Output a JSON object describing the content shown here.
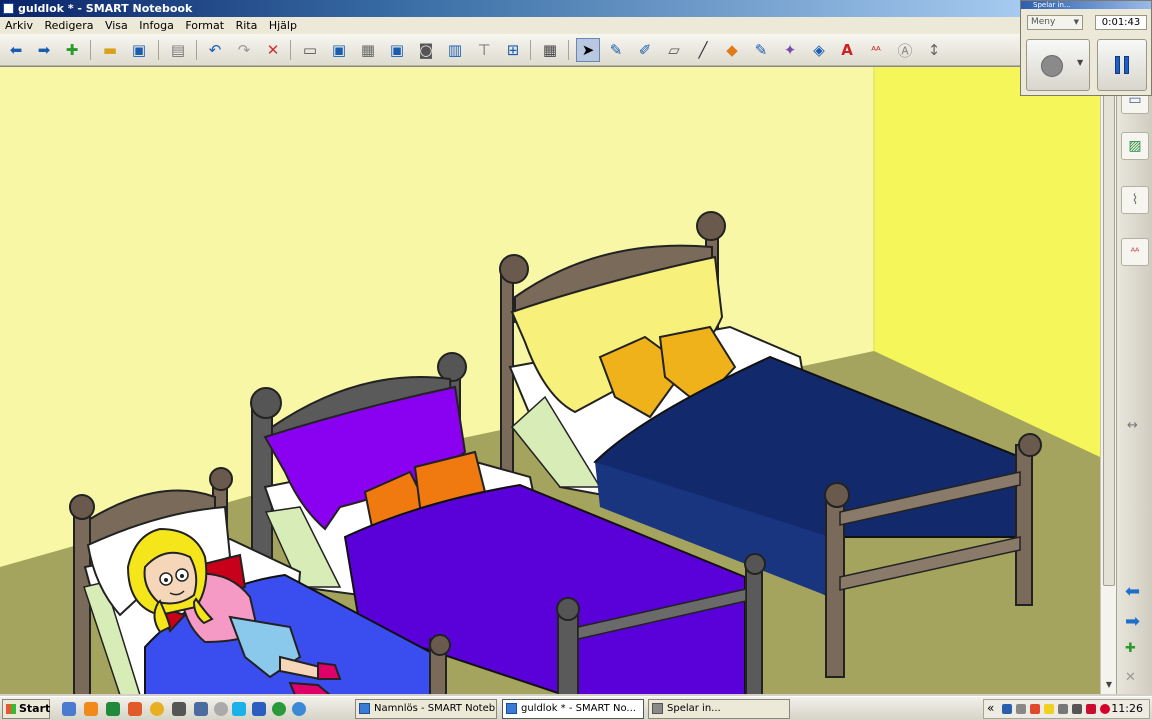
{
  "window": {
    "title": "guldlok * - SMART Notebook"
  },
  "menu": [
    "Arkiv",
    "Redigera",
    "Visa",
    "Infoga",
    "Format",
    "Rita",
    "Hjälp"
  ],
  "toolbar": {
    "buttons": [
      "back-icon",
      "forward-icon",
      "add-page-icon",
      "open-icon",
      "save-icon",
      "paste-icon",
      "undo-icon",
      "redo-icon",
      "delete-icon",
      "screen-shade-icon",
      "full-screen-icon",
      "transparent-background-icon",
      "screen-view-icon",
      "capture-icon",
      "document-camera-icon",
      "measurement-tools-icon",
      "properties-icon",
      "table-icon",
      "select-icon",
      "pen-icon",
      "creative-pen-icon",
      "eraser-icon",
      "line-icon",
      "shapes-icon",
      "magic-pen-icon",
      "fill-icon",
      "text-icon",
      "text-color-icon",
      "recognition-icon",
      "more-icon"
    ],
    "selected": "select-icon"
  },
  "recorder": {
    "title": "Spelar in...",
    "menu_label": "Meny",
    "elapsed": "0:01:43"
  },
  "sidebar": {
    "tabs": [
      "page-sorter-icon",
      "gallery-icon",
      "attachments-icon",
      "properties-tab-icon"
    ],
    "resize_icon": "double-arrow-icon"
  },
  "taskbar": {
    "start_label": "Start",
    "tasks": [
      {
        "label": "Namnlös - SMART Noteb...",
        "active": false
      },
      {
        "label": "guldlok * - SMART No...",
        "active": true
      },
      {
        "label": "Spelar in...",
        "active": false
      }
    ],
    "tray_collapse": "«",
    "clock": "11:26"
  },
  "colors": {
    "wall": "#f7f7a6",
    "wall_right": "#f4f65a",
    "floor": "#a4a45e",
    "small_bed_cover": "#3a4ef0",
    "medium_bed_cover": "#5a00d8",
    "large_bed_cover": "#122a6c",
    "accent_blue": "#1f5fc4"
  }
}
